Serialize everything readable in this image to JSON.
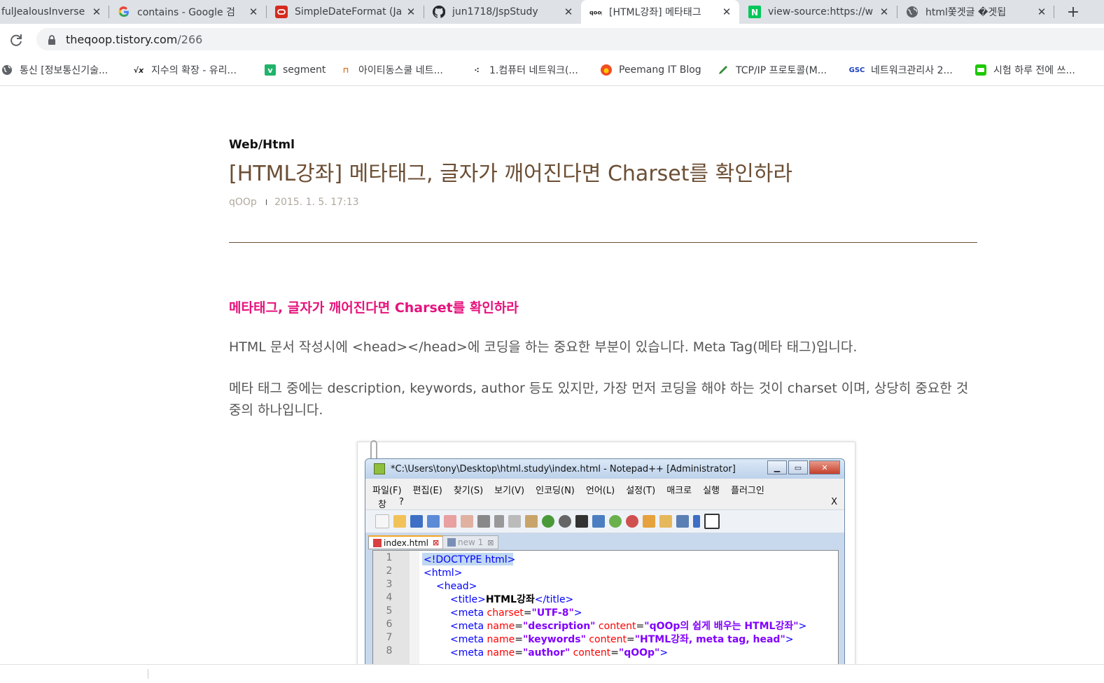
{
  "tabs": [
    {
      "title": "fulJealousInverse",
      "favicon": "generic-icon"
    },
    {
      "title": "contains - Google 검",
      "favicon": "google-icon"
    },
    {
      "title": "SimpleDateFormat (Ja",
      "favicon": "oracle-icon"
    },
    {
      "title": "jun1718/JspStudy",
      "favicon": "github-icon"
    },
    {
      "title": "[HTML강좌] 메타태그",
      "favicon": "qoop-icon",
      "active": true
    },
    {
      "title": "view-source:https://w",
      "favicon": "naver-icon"
    },
    {
      "title": "html쫓겟글 �겟됩",
      "favicon": "globe-icon"
    }
  ],
  "new_tab_label": "+",
  "address": {
    "host": "theqoop.tistory.com",
    "path": "/266"
  },
  "bookmarks": [
    {
      "label": "통신 [정보통신기술...",
      "icon": "globe-icon"
    },
    {
      "label": "지수의 확장 - 유리...",
      "icon": "sqrt-icon"
    },
    {
      "label": "segment",
      "icon": "v-icon"
    },
    {
      "label": "아이티동스쿨 네트...",
      "icon": "it-icon"
    },
    {
      "label": "1.컴퓨터 네트워크(...",
      "icon": "dots-icon"
    },
    {
      "label": "Peemang IT Blog",
      "icon": "peemang-icon"
    },
    {
      "label": "TCP/IP 프로토콜(M...",
      "icon": "pen-icon"
    },
    {
      "label": "네트워크관리사 2...",
      "icon": "gsc-icon"
    },
    {
      "label": "시험 하루 전에 쓰...",
      "icon": "chat-icon"
    }
  ],
  "post": {
    "category": "Web/Html",
    "title": "[HTML강좌] 메타태그, 글자가 깨어진다면 Charset를 확인하라",
    "author": "qOOp",
    "meta_sep": "I",
    "date": "2015. 1. 5. 17:13",
    "subheading": "메타태그, 글자가 깨어진다면 Charset를 확인하라",
    "para1": "HTML 문서 작성시에 <head></head>에 코딩을 하는 중요한 부분이 있습니다. Meta Tag(메타 태그)입니다.",
    "para2": "메타 태그 중에는 description, keywords, author 등도 있지만, 가장 먼저 코딩을 해야 하는 것이 charset 이며, 상당히 중요한 것 중의 하나입니다."
  },
  "screenshot": {
    "window_title": "*C:\\Users\\tony\\Desktop\\html.study\\index.html - Notepad++ [Administrator]",
    "menu_row1": [
      "파일(F)",
      "편집(E)",
      "찾기(S)",
      "보기(V)",
      "인코딩(N)",
      "언어(L)",
      "설정(T)",
      "매크로",
      "실행",
      "플러그인"
    ],
    "menu_row2": [
      "창",
      "?"
    ],
    "menu_close": "X",
    "tabs": [
      "index.html",
      "new  1"
    ],
    "line_numbers": [
      "1",
      "2",
      "3",
      "4",
      "5",
      "6",
      "7",
      "8"
    ]
  }
}
